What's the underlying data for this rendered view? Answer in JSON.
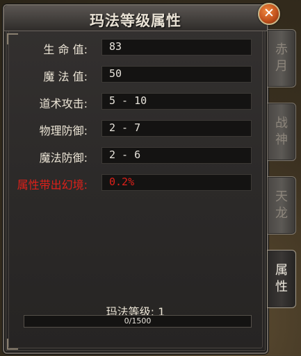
{
  "window": {
    "title": "玛法等级属性",
    "close_symbol": "✕"
  },
  "attributes": [
    {
      "label": "生 命 值:",
      "value": "83"
    },
    {
      "label": "魔 法 值:",
      "value": "50"
    },
    {
      "label": "道术攻击:",
      "value": "5 - 10"
    },
    {
      "label": "物理防御:",
      "value": "2 - 7"
    },
    {
      "label": "魔法防御:",
      "value": "2 - 6"
    },
    {
      "label": "属性带出幻境:",
      "value": "0.2%",
      "highlight": true
    }
  ],
  "tabs": [
    {
      "line1": "赤",
      "line2": "月",
      "active": false
    },
    {
      "line1": "战",
      "line2": "神",
      "active": false
    },
    {
      "line1": "天",
      "line2": "龙",
      "active": false
    },
    {
      "line1": "属",
      "line2": "性",
      "active": true
    }
  ],
  "level": {
    "label": "玛法等级: 1",
    "progress_text": "0/1500",
    "progress_fraction": 0
  },
  "colors": {
    "highlight_red": "#e0201a",
    "text": "#ece5d6"
  }
}
